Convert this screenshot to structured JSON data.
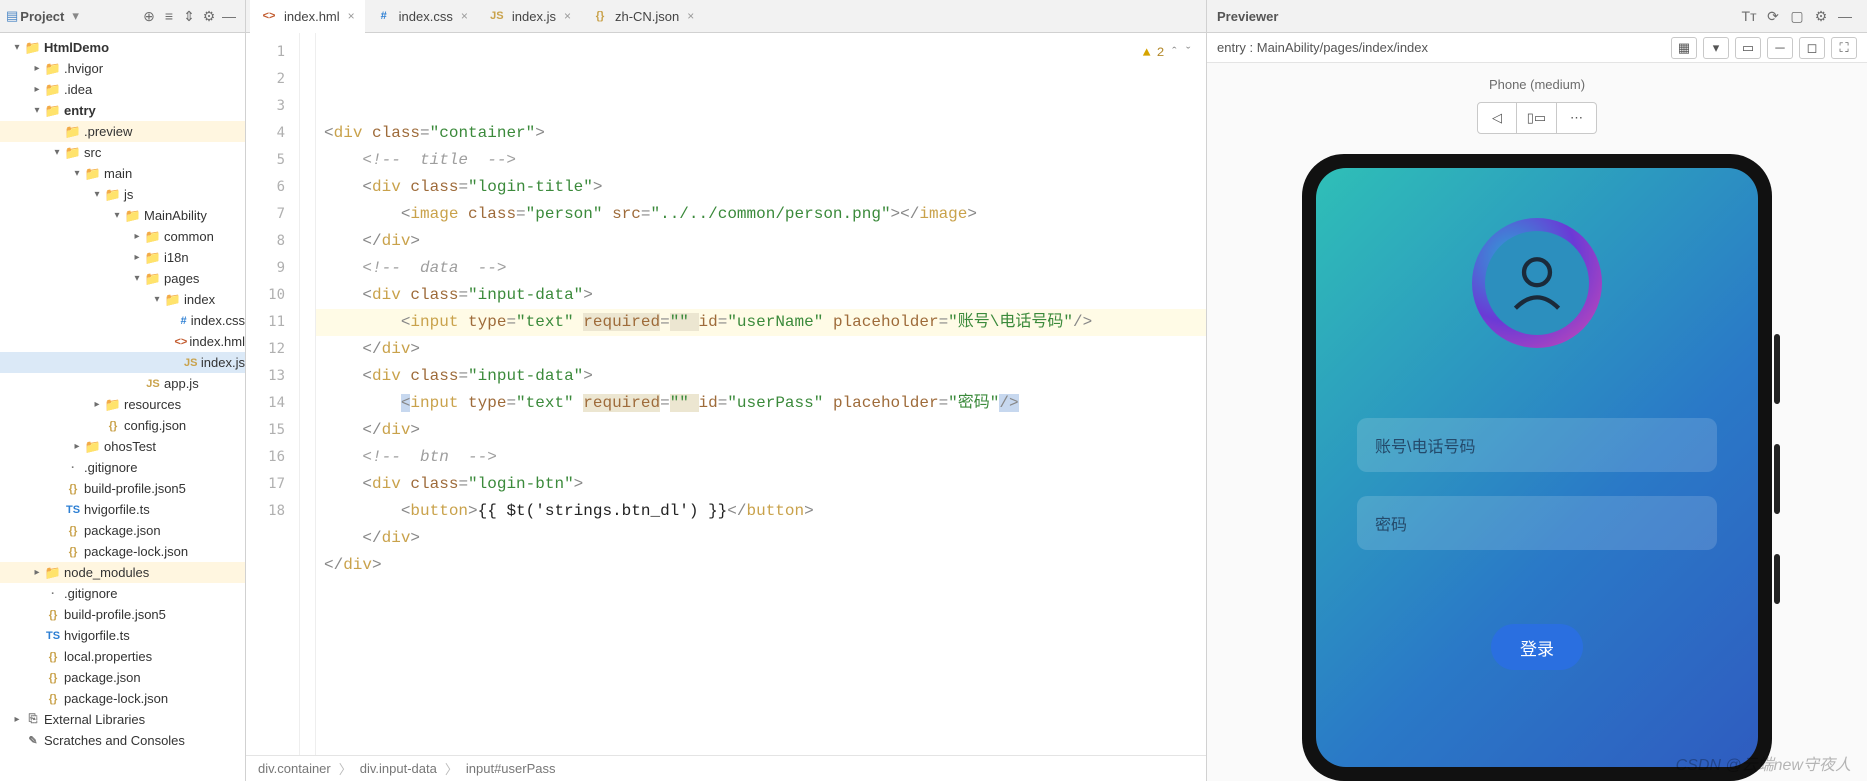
{
  "toolbar": {
    "project_label": "Project",
    "icons": [
      "target",
      "expand",
      "collapse",
      "gear",
      "hide"
    ]
  },
  "tree": {
    "nodes": [
      {
        "depth": 0,
        "expand": "open",
        "icon": "folder-blue",
        "label": "HtmlDemo",
        "bold": true
      },
      {
        "depth": 1,
        "expand": "closed",
        "icon": "folder",
        "label": ".hvigor"
      },
      {
        "depth": 1,
        "expand": "closed",
        "icon": "folder",
        "label": ".idea"
      },
      {
        "depth": 1,
        "expand": "open",
        "icon": "folder-blue",
        "label": "entry",
        "bold": true
      },
      {
        "depth": 2,
        "expand": "leaf",
        "icon": "folder-orange",
        "label": ".preview",
        "highlight": true
      },
      {
        "depth": 2,
        "expand": "open",
        "icon": "folder",
        "label": "src"
      },
      {
        "depth": 3,
        "expand": "open",
        "icon": "folder",
        "label": "main"
      },
      {
        "depth": 4,
        "expand": "open",
        "icon": "folder",
        "label": "js"
      },
      {
        "depth": 5,
        "expand": "open",
        "icon": "folder",
        "label": "MainAbility"
      },
      {
        "depth": 6,
        "expand": "closed",
        "icon": "folder",
        "label": "common"
      },
      {
        "depth": 6,
        "expand": "closed",
        "icon": "folder",
        "label": "i18n"
      },
      {
        "depth": 6,
        "expand": "open",
        "icon": "folder",
        "label": "pages"
      },
      {
        "depth": 7,
        "expand": "open",
        "icon": "folder",
        "label": "index"
      },
      {
        "depth": 8,
        "expand": "leaf",
        "icon": "file-css",
        "label": "index.css"
      },
      {
        "depth": 8,
        "expand": "leaf",
        "icon": "file-hml",
        "label": "index.hml"
      },
      {
        "depth": 8,
        "expand": "leaf",
        "icon": "file-js",
        "label": "index.js",
        "selected": true
      },
      {
        "depth": 6,
        "expand": "leaf",
        "icon": "file-js",
        "label": "app.js"
      },
      {
        "depth": 4,
        "expand": "closed",
        "icon": "folder",
        "label": "resources"
      },
      {
        "depth": 4,
        "expand": "leaf",
        "icon": "file-json",
        "label": "config.json"
      },
      {
        "depth": 3,
        "expand": "closed",
        "icon": "folder",
        "label": "ohosTest"
      },
      {
        "depth": 2,
        "expand": "leaf",
        "icon": "file-gen",
        "label": ".gitignore"
      },
      {
        "depth": 2,
        "expand": "leaf",
        "icon": "file-json",
        "label": "build-profile.json5"
      },
      {
        "depth": 2,
        "expand": "leaf",
        "icon": "file-ts",
        "label": "hvigorfile.ts"
      },
      {
        "depth": 2,
        "expand": "leaf",
        "icon": "file-json",
        "label": "package.json"
      },
      {
        "depth": 2,
        "expand": "leaf",
        "icon": "file-json",
        "label": "package-lock.json"
      },
      {
        "depth": 1,
        "expand": "closed",
        "icon": "folder-orange",
        "label": "node_modules",
        "highlight": true
      },
      {
        "depth": 1,
        "expand": "leaf",
        "icon": "file-gen",
        "label": ".gitignore"
      },
      {
        "depth": 1,
        "expand": "leaf",
        "icon": "file-json",
        "label": "build-profile.json5"
      },
      {
        "depth": 1,
        "expand": "leaf",
        "icon": "file-ts",
        "label": "hvigorfile.ts"
      },
      {
        "depth": 1,
        "expand": "leaf",
        "icon": "file-json",
        "label": "local.properties"
      },
      {
        "depth": 1,
        "expand": "leaf",
        "icon": "file-json",
        "label": "package.json"
      },
      {
        "depth": 1,
        "expand": "leaf",
        "icon": "file-json",
        "label": "package-lock.json"
      },
      {
        "depth": 0,
        "expand": "closed",
        "icon": "lib",
        "label": "External Libraries"
      },
      {
        "depth": 0,
        "expand": "leaf",
        "icon": "scratch",
        "label": "Scratches and Consoles"
      }
    ]
  },
  "tabs": [
    {
      "icon": "hml",
      "label": "index.hml",
      "close": true,
      "active": true
    },
    {
      "icon": "css",
      "label": "index.css",
      "close": true
    },
    {
      "icon": "js",
      "label": "index.js",
      "close": true
    },
    {
      "icon": "json",
      "label": "zh-CN.json",
      "close": true
    }
  ],
  "editor": {
    "warning_count": "2",
    "highlight_line": 11,
    "lines": [
      {
        "n": 1,
        "tokens": [
          [
            "punc",
            "<"
          ],
          [
            "tag",
            "div "
          ],
          [
            "attr",
            "class"
          ],
          [
            "punc",
            "="
          ],
          [
            "val",
            "\"container\""
          ],
          [
            "punc",
            ">"
          ]
        ]
      },
      {
        "n": 2,
        "tokens": [
          [
            "comment",
            "<!--  title  -->"
          ]
        ]
      },
      {
        "n": 3,
        "tokens": [
          [
            "punc",
            "<"
          ],
          [
            "tag",
            "div "
          ],
          [
            "attr",
            "class"
          ],
          [
            "punc",
            "="
          ],
          [
            "val",
            "\"login-title\""
          ],
          [
            "punc",
            ">"
          ]
        ]
      },
      {
        "n": 4,
        "tokens": [
          [
            "punc",
            "<"
          ],
          [
            "tag",
            "image "
          ],
          [
            "attr",
            "class"
          ],
          [
            "punc",
            "="
          ],
          [
            "val",
            "\"person\" "
          ],
          [
            "attr",
            "src"
          ],
          [
            "punc",
            "="
          ],
          [
            "val",
            "\"../../common/person.png\""
          ],
          [
            "punc",
            "></"
          ],
          [
            "tag",
            "image"
          ],
          [
            "punc",
            ">"
          ]
        ]
      },
      {
        "n": 5,
        "tokens": [
          [
            "punc",
            "</"
          ],
          [
            "tag",
            "div"
          ],
          [
            "punc",
            ">"
          ]
        ]
      },
      {
        "n": 6,
        "tokens": [
          [
            "comment",
            "<!--  data  -->"
          ]
        ]
      },
      {
        "n": 7,
        "tokens": [
          [
            "punc",
            "<"
          ],
          [
            "tag",
            "div "
          ],
          [
            "attr",
            "class"
          ],
          [
            "punc",
            "="
          ],
          [
            "val",
            "\"input-data\""
          ],
          [
            "punc",
            ">"
          ]
        ]
      },
      {
        "n": 8,
        "tokens": [
          [
            "punc",
            "<"
          ],
          [
            "tag",
            "input "
          ],
          [
            "attr",
            "type"
          ],
          [
            "punc",
            "="
          ],
          [
            "val",
            "\"text\" "
          ],
          [
            "reqattr",
            "required"
          ],
          [
            "punc",
            "="
          ],
          [
            "reqval",
            "\"\" "
          ],
          [
            "attr",
            "id"
          ],
          [
            "punc",
            "="
          ],
          [
            "val",
            "\"userName\" "
          ],
          [
            "attr",
            "placeholder"
          ],
          [
            "punc",
            "="
          ],
          [
            "val",
            "\"账号\\电话号码\""
          ],
          [
            "punc",
            "/>"
          ]
        ]
      },
      {
        "n": 9,
        "tokens": [
          [
            "punc",
            "</"
          ],
          [
            "tag",
            "div"
          ],
          [
            "punc",
            ">"
          ]
        ]
      },
      {
        "n": 10,
        "tokens": [
          [
            "punc",
            "<"
          ],
          [
            "tag",
            "div "
          ],
          [
            "attr",
            "class"
          ],
          [
            "punc",
            "="
          ],
          [
            "val",
            "\"input-data\""
          ],
          [
            "punc",
            ">"
          ]
        ]
      },
      {
        "n": 11,
        "tokens": [
          [
            "selpunc",
            "<"
          ],
          [
            "tag",
            "input "
          ],
          [
            "attr",
            "type"
          ],
          [
            "punc",
            "="
          ],
          [
            "val",
            "\"text\" "
          ],
          [
            "reqattr",
            "required"
          ],
          [
            "punc",
            "="
          ],
          [
            "reqval",
            "\"\" "
          ],
          [
            "attr",
            "id"
          ],
          [
            "punc",
            "="
          ],
          [
            "val",
            "\"userPass\" "
          ],
          [
            "attr",
            "placeholder"
          ],
          [
            "punc",
            "="
          ],
          [
            "val",
            "\"密码\""
          ],
          [
            "selpunc",
            "/>"
          ]
        ]
      },
      {
        "n": 12,
        "tokens": [
          [
            "punc",
            "</"
          ],
          [
            "tag",
            "div"
          ],
          [
            "punc",
            ">"
          ]
        ]
      },
      {
        "n": 13,
        "tokens": [
          [
            "comment",
            "<!--  btn  -->"
          ]
        ]
      },
      {
        "n": 14,
        "tokens": [
          [
            "punc",
            "<"
          ],
          [
            "tag",
            "div "
          ],
          [
            "attr",
            "class"
          ],
          [
            "punc",
            "="
          ],
          [
            "val",
            "\"login-btn\""
          ],
          [
            "punc",
            ">"
          ]
        ]
      },
      {
        "n": 15,
        "tokens": [
          [
            "punc",
            "<"
          ],
          [
            "tag",
            "button"
          ],
          [
            "punc",
            ">"
          ],
          [
            "text",
            "{{ $t('strings.btn_dl') }}"
          ],
          [
            "punc",
            "</"
          ],
          [
            "tag",
            "button"
          ],
          [
            "punc",
            ">"
          ]
        ]
      },
      {
        "n": 16,
        "tokens": [
          [
            "punc",
            "</"
          ],
          [
            "tag",
            "div"
          ],
          [
            "punc",
            ">"
          ]
        ]
      },
      {
        "n": 17,
        "tokens": [
          [
            "punc",
            "</"
          ],
          [
            "tag",
            "div"
          ],
          [
            "punc",
            ">"
          ]
        ]
      },
      {
        "n": 18,
        "tokens": []
      }
    ],
    "indent": [
      0,
      1,
      1,
      2,
      1,
      1,
      1,
      2,
      1,
      1,
      2,
      1,
      1,
      1,
      2,
      1,
      0,
      0
    ]
  },
  "crumbs": [
    "div.container",
    "div.input-data",
    "input#userPass"
  ],
  "previewer": {
    "title": "Previewer",
    "entry_label": "entry : MainAbility/pages/index/index",
    "phone_label": "Phone (medium)",
    "field1_placeholder": "账号\\电话号码",
    "field2_placeholder": "密码",
    "login_btn": "登录"
  },
  "watermark": "CSDN @云端new守夜人"
}
